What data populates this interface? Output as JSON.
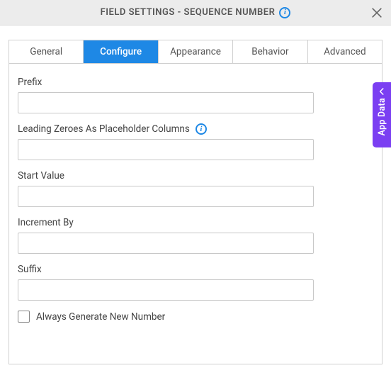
{
  "header": {
    "title": "FIELD SETTINGS - SEQUENCE NUMBER"
  },
  "tabs": {
    "general": "General",
    "configure": "Configure",
    "appearance": "Appearance",
    "behavior": "Behavior",
    "advanced": "Advanced",
    "active": "configure"
  },
  "fields": {
    "prefix": {
      "label": "Prefix",
      "value": ""
    },
    "leading_zeroes": {
      "label": "Leading Zeroes As Placeholder Columns",
      "value": ""
    },
    "start_value": {
      "label": "Start Value",
      "value": ""
    },
    "increment_by": {
      "label": "Increment By",
      "value": ""
    },
    "suffix": {
      "label": "Suffix",
      "value": ""
    },
    "always_generate": {
      "label": "Always Generate New Number",
      "checked": false
    }
  },
  "side_panel": {
    "label": "App Data"
  }
}
